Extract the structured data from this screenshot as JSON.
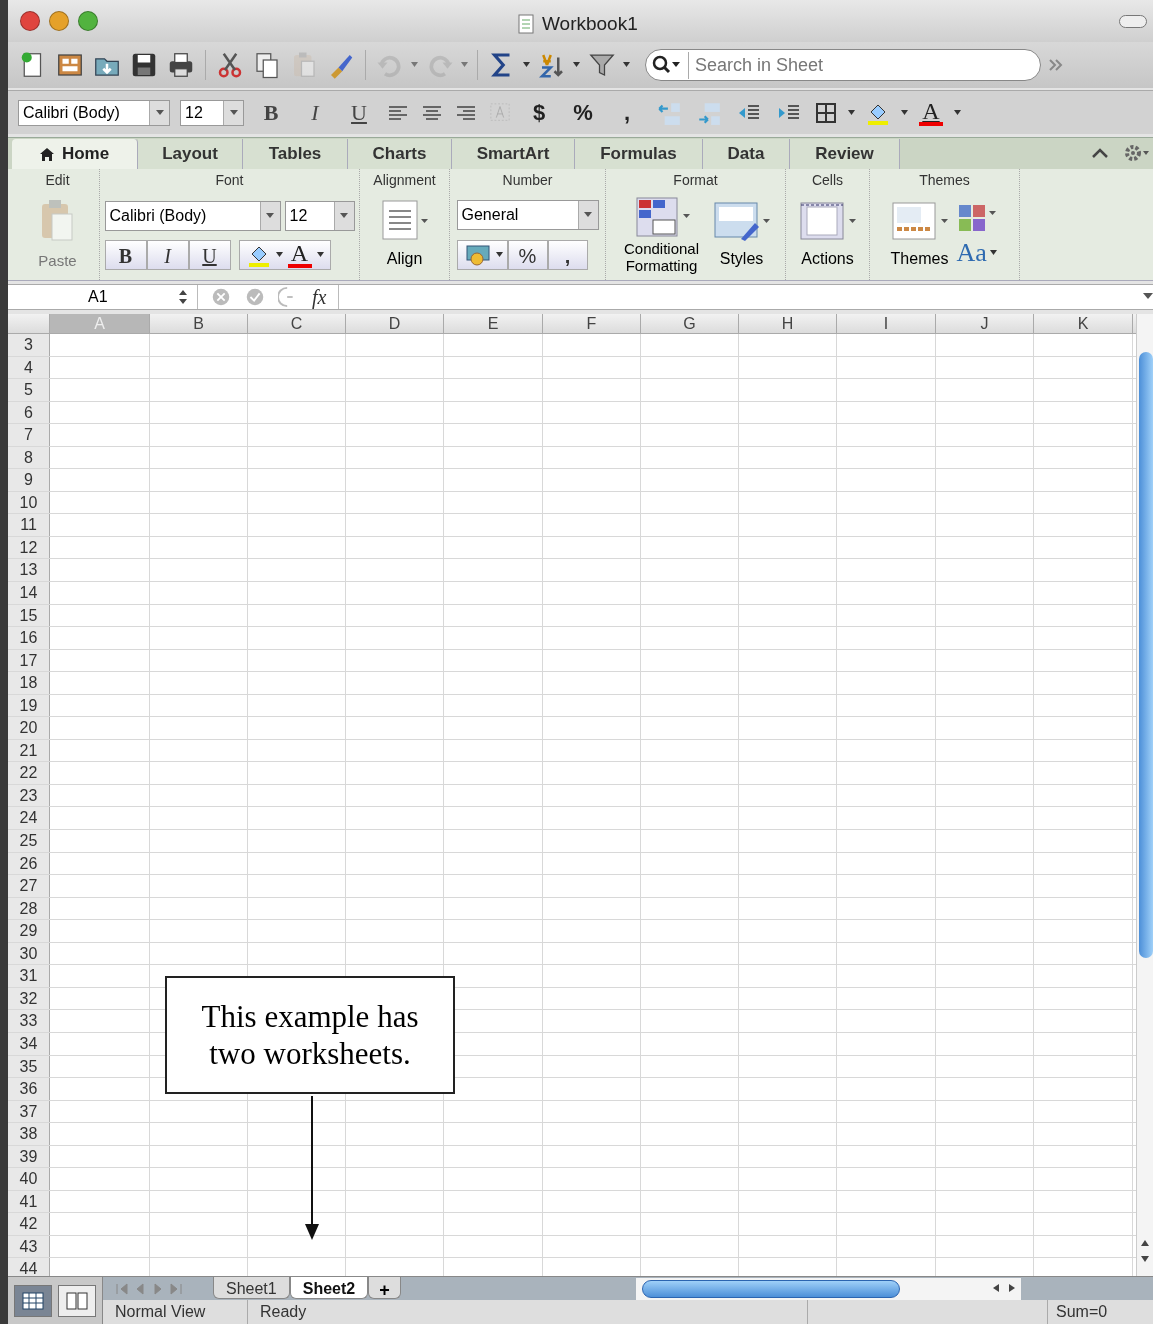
{
  "window": {
    "title": "Workbook1"
  },
  "toolbar": {
    "buttons": [
      {
        "kind": "new",
        "disabled": false,
        "caret": false
      },
      {
        "kind": "gallery",
        "disabled": false,
        "caret": false
      },
      {
        "kind": "open",
        "disabled": false,
        "caret": false
      },
      {
        "kind": "save",
        "disabled": false,
        "caret": false
      },
      {
        "kind": "print",
        "disabled": false,
        "caret": false
      },
      {
        "kind": "cut",
        "disabled": false,
        "caret": false
      },
      {
        "kind": "copy",
        "disabled": false,
        "caret": false
      },
      {
        "kind": "paste",
        "disabled": true,
        "caret": false
      },
      {
        "kind": "brush",
        "disabled": false,
        "caret": false
      },
      {
        "kind": "undo",
        "disabled": true,
        "caret": true
      },
      {
        "kind": "redo",
        "disabled": true,
        "caret": true
      },
      {
        "kind": "sum",
        "disabled": false,
        "caret": true
      },
      {
        "kind": "sort",
        "disabled": false,
        "caret": true
      },
      {
        "kind": "filter",
        "disabled": false,
        "caret": true
      }
    ],
    "search": {
      "placeholder": "Search in Sheet"
    }
  },
  "format_bar": {
    "font": "Calibri (Body)",
    "size": "12",
    "style_buttons": [
      "B",
      "I",
      "U"
    ],
    "number_buttons": [
      "$",
      "%",
      ","
    ],
    "font_color_label": "A"
  },
  "ribbon": {
    "tabs": [
      {
        "label": "Home",
        "selected": true
      },
      {
        "label": "Layout",
        "selected": false
      },
      {
        "label": "Tables",
        "selected": false
      },
      {
        "label": "Charts",
        "selected": false
      },
      {
        "label": "SmartArt",
        "selected": false
      },
      {
        "label": "Formulas",
        "selected": false
      },
      {
        "label": "Data",
        "selected": false
      },
      {
        "label": "Review",
        "selected": false
      }
    ],
    "groups": [
      {
        "kind": "edit",
        "title": "Edit",
        "labels": [
          "Paste"
        ]
      },
      {
        "kind": "font",
        "title": "Font",
        "labels": [
          "Calibri (Body)",
          "12",
          "B",
          "I",
          "U",
          "A"
        ]
      },
      {
        "kind": "alignment",
        "title": "Alignment",
        "labels": [
          "Align"
        ]
      },
      {
        "kind": "number",
        "title": "Number",
        "labels": [
          "General",
          "%",
          ","
        ]
      },
      {
        "kind": "format",
        "title": "Format",
        "labels": [
          "Conditional Formatting",
          "Styles"
        ]
      },
      {
        "kind": "cells",
        "title": "Cells",
        "labels": [
          "Actions"
        ]
      },
      {
        "kind": "themes",
        "title": "Themes",
        "labels": [
          "Themes",
          "Aa"
        ]
      }
    ]
  },
  "formula_bar": {
    "cell_ref": "A1",
    "fx": "fx"
  },
  "sheet": {
    "columns": [
      {
        "label": "A",
        "selected": true
      },
      {
        "label": "B",
        "selected": false
      },
      {
        "label": "C",
        "selected": false
      },
      {
        "label": "D",
        "selected": false
      },
      {
        "label": "E",
        "selected": false
      },
      {
        "label": "F",
        "selected": false
      },
      {
        "label": "G",
        "selected": false
      },
      {
        "label": "H",
        "selected": false
      },
      {
        "label": "I",
        "selected": false
      },
      {
        "label": "J",
        "selected": false
      },
      {
        "label": "K",
        "selected": false
      }
    ],
    "rows": [
      "3",
      "4",
      "5",
      "6",
      "7",
      "8",
      "9",
      "10",
      "11",
      "12",
      "13",
      "14",
      "15",
      "16",
      "17",
      "18",
      "19",
      "20",
      "21",
      "22",
      "23",
      "24",
      "25",
      "26",
      "27",
      "28",
      "29",
      "30",
      "31",
      "32",
      "33",
      "34",
      "35",
      "36",
      "37",
      "38",
      "39",
      "40",
      "41",
      "42",
      "43",
      "44"
    ]
  },
  "annotation": {
    "text": "This example has two worksheets."
  },
  "sheet_tabs": {
    "tabs": [
      {
        "label": "Sheet1",
        "selected": false
      },
      {
        "label": "Sheet2",
        "selected": true
      }
    ],
    "add": "+"
  },
  "status_bar": {
    "views": [
      {
        "kind": "normal",
        "selected": true
      },
      {
        "kind": "page-layout",
        "selected": false
      }
    ],
    "view_name": "Normal View",
    "status": "Ready",
    "sum": "Sum=0"
  }
}
